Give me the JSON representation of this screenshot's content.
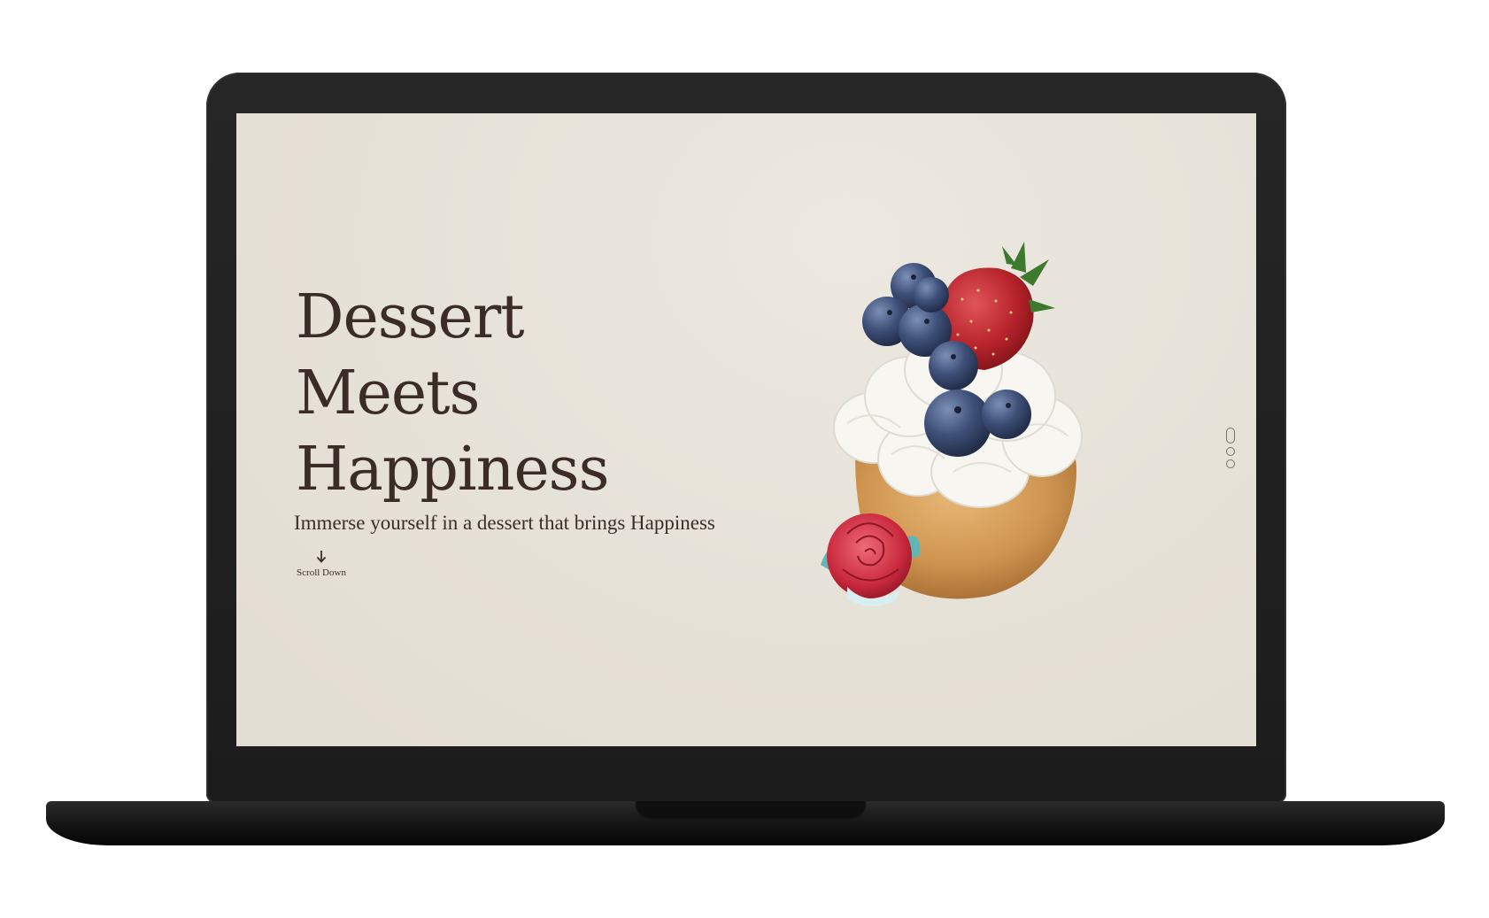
{
  "hero": {
    "title_lines": [
      "Dessert",
      "Meets",
      "Happiness"
    ],
    "subtitle": "Immerse yourself in a dessert that brings Happiness",
    "scroll_label": "Scroll Down"
  },
  "slider": {
    "dot_count": 3,
    "active_index": 0
  },
  "icons": {
    "scroll": "arrow-down-icon",
    "image": "cupcake-illustration"
  },
  "colors": {
    "screen_background": "#e6e1d7",
    "text": "#3b2c27",
    "laptop_body": "#1f1f1f"
  }
}
